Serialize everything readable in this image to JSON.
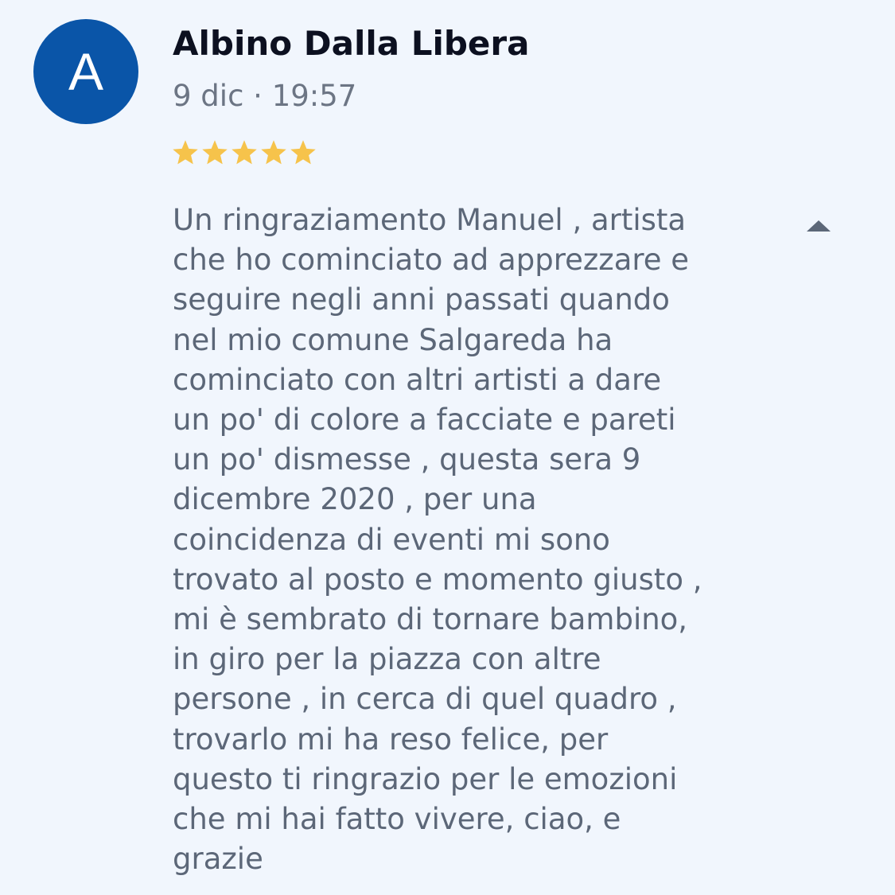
{
  "review": {
    "avatar_letter": "A",
    "avatar_color": "#0a55a8",
    "author": "Albino Dalla Libera",
    "timestamp": "9 dic · 19:57",
    "rating": 5,
    "rating_max": 5,
    "star_color": "#f6c34b",
    "text": "Un ringraziamento Manuel , artista\nche ho cominciato ad apprezzare e\nseguire negli anni passati quando\nnel mio comune Salgareda ha\ncominciato con altri artisti a dare\nun po' di colore a facciate e pareti\nun po' dismesse , questa sera 9\ndicembre 2020 , per una\ncoincidenza di eventi mi sono\ntrovato al posto e momento giusto ,\nmi è sembrato di tornare bambino,\nin giro per la piazza con altre\npersone , in cerca di quel quadro ,\ntrovarlo  mi ha reso felice, per\nquesto ti ringrazio per le emozioni\nche mi hai fatto vivere, ciao, e\ngrazie",
    "collapse_icon": "caret-up-icon"
  }
}
